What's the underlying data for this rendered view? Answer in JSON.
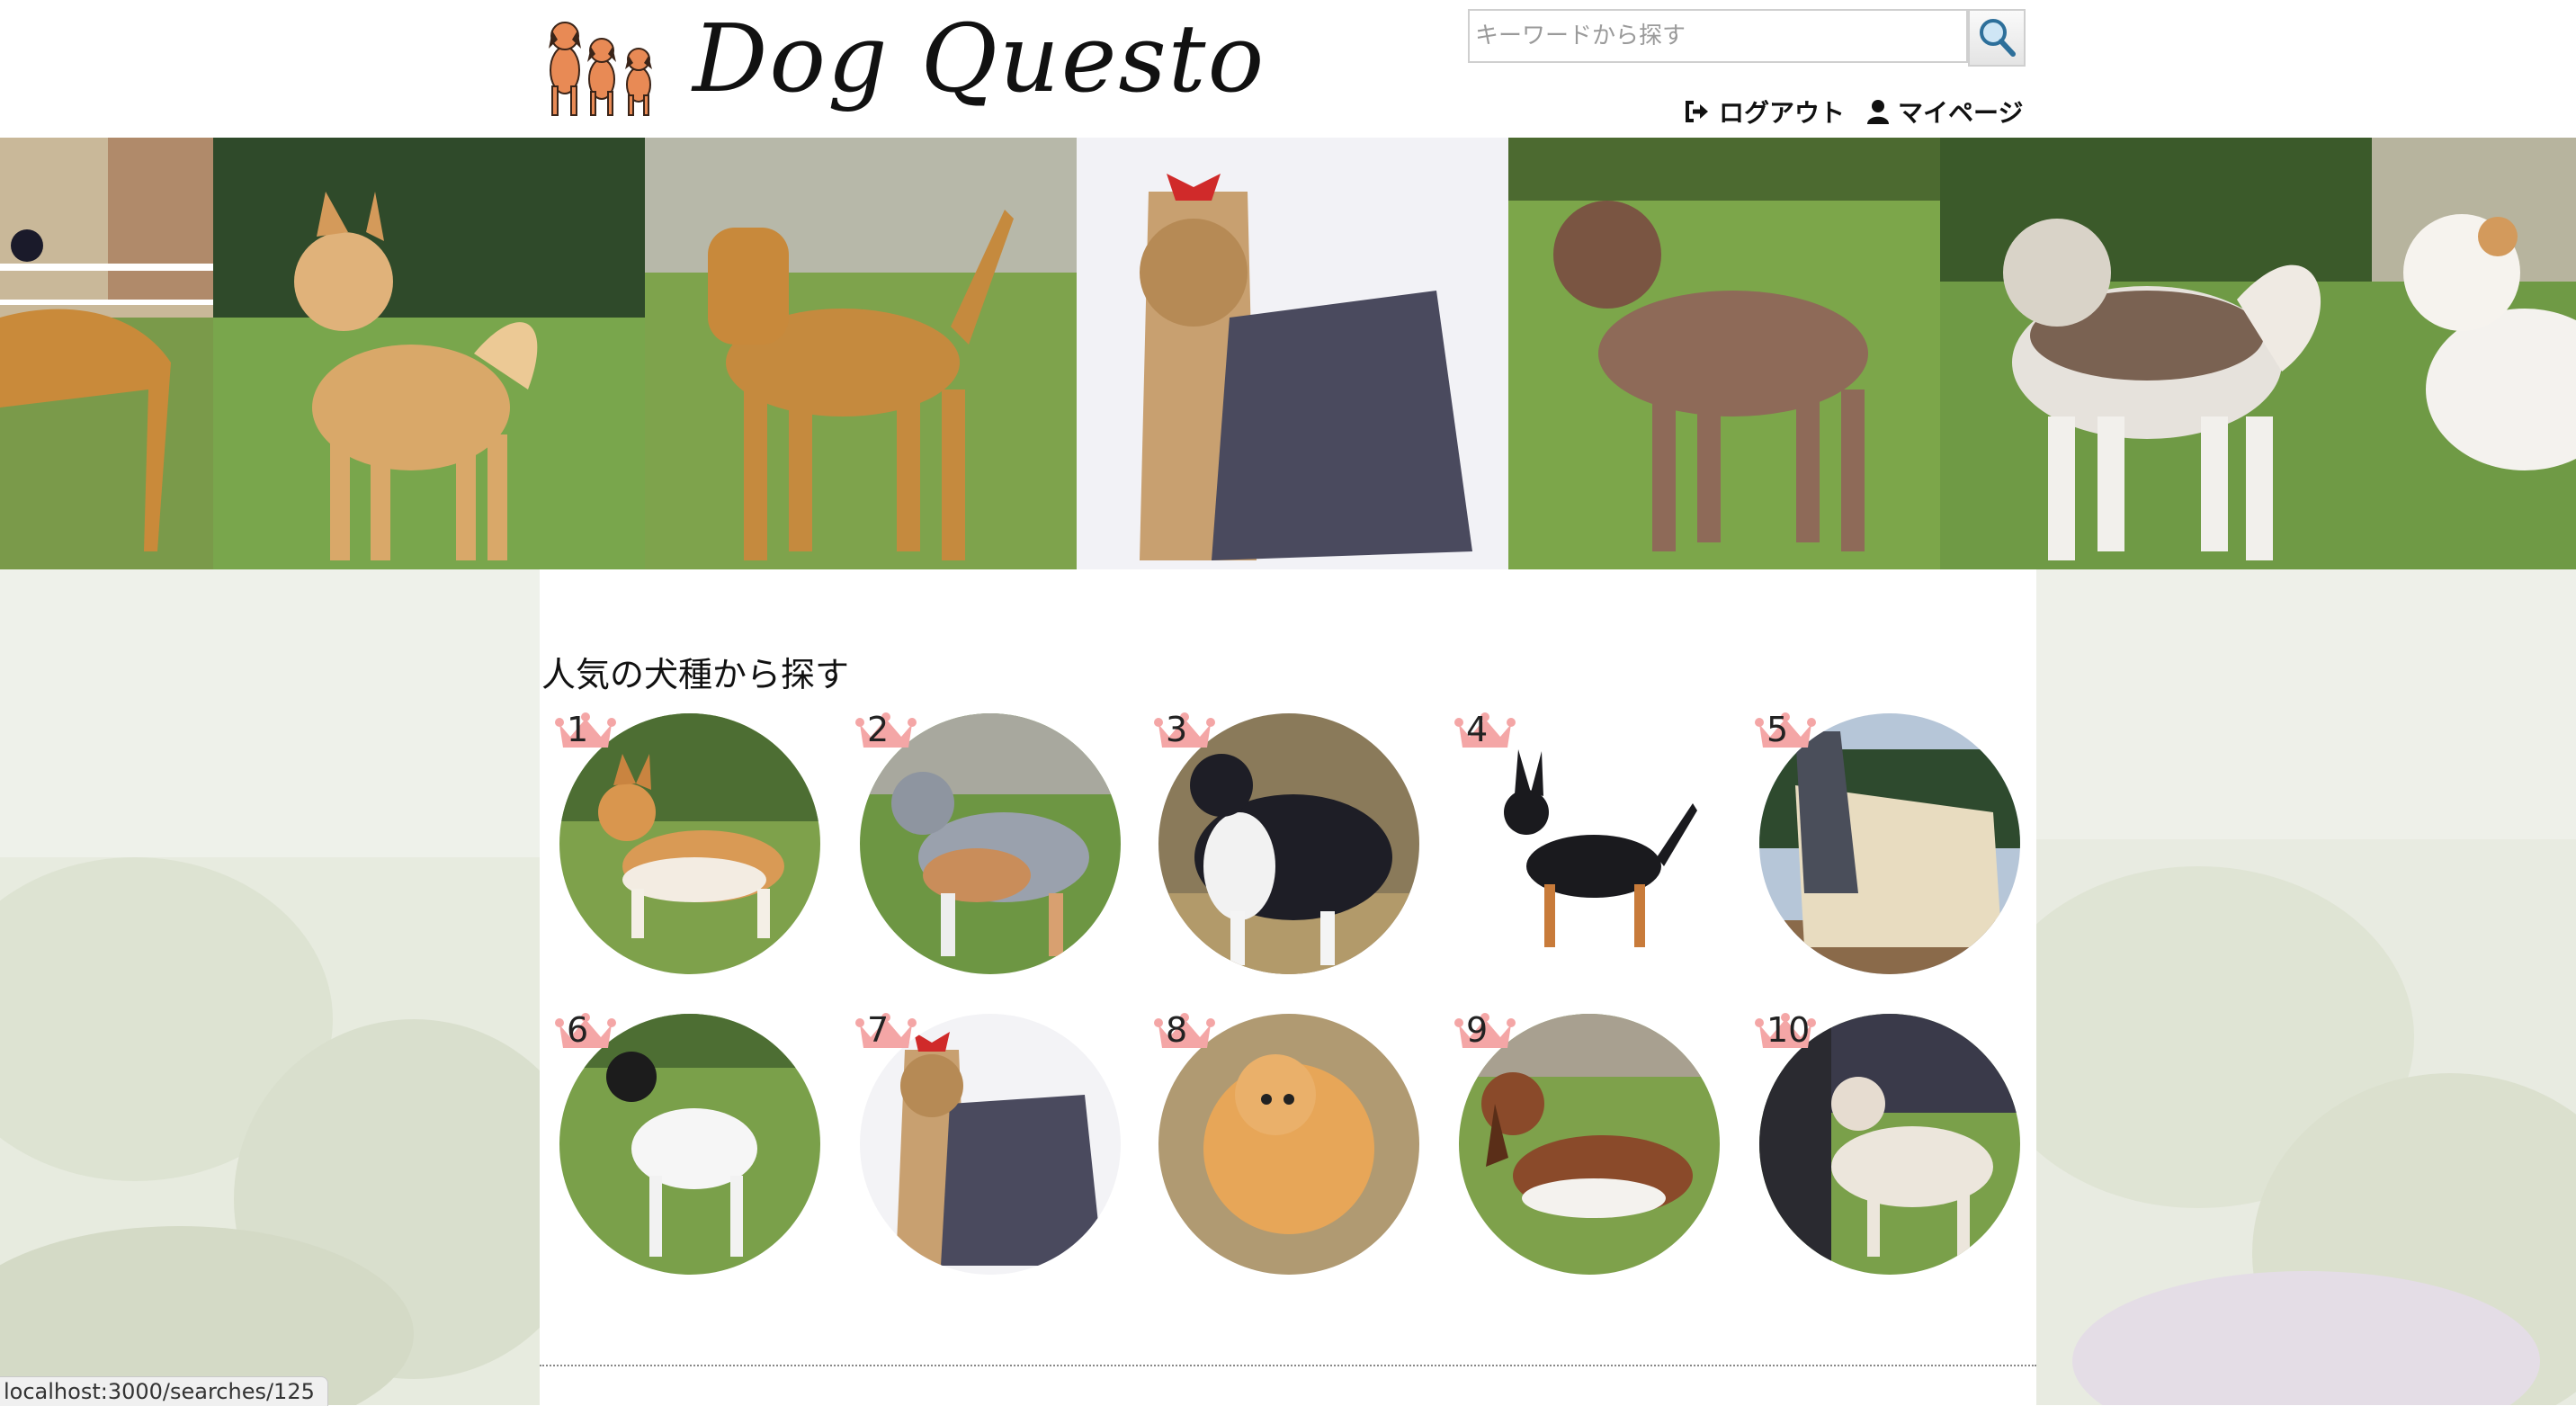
{
  "header": {
    "logo_text": "Dog Questo",
    "search": {
      "placeholder": "キーワードから探す",
      "value": ""
    },
    "nav": {
      "logout": "ログアウト",
      "mypage": "マイページ"
    }
  },
  "popular": {
    "title": "人気の犬種から探す",
    "ranks": [
      "1",
      "2",
      "3",
      "4",
      "5",
      "6",
      "7",
      "8",
      "9",
      "10"
    ]
  },
  "status_bar": {
    "url": "localhost:3000/searches/125"
  },
  "colors": {
    "crown": "#f4a6a6",
    "divider": "#888888",
    "text": "#111111"
  }
}
